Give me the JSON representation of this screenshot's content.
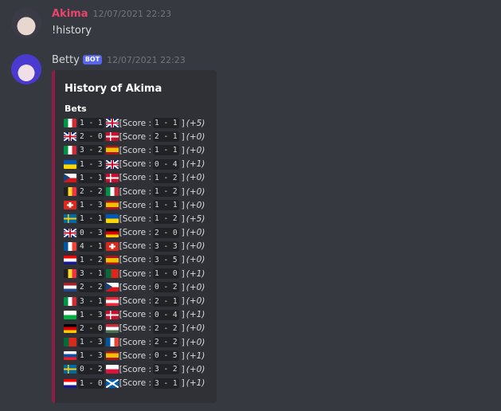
{
  "messages": [
    {
      "author": "Akima",
      "timestamp": "12/07/2021 22:23",
      "text": "!history"
    },
    {
      "author": "Betty",
      "bot_tag": "BOT",
      "timestamp": "12/07/2021 22:23",
      "embed": {
        "title": "History of Akima",
        "field": "Bets",
        "score_label": "[Score :",
        "bets": [
          {
            "home_icon": "flag-italy",
            "away_icon": "flag-uk",
            "bet": "1 - 1",
            "score": "1 - 1",
            "points": "(+5)"
          },
          {
            "home_icon": "flag-uk",
            "away_icon": "flag-denmark",
            "bet": "2 - 0",
            "score": "2 - 1",
            "points": "(+0)"
          },
          {
            "home_icon": "flag-italy",
            "away_icon": "flag-spain",
            "bet": "3 - 2",
            "score": "1 - 1",
            "points": "(+0)"
          },
          {
            "home_icon": "flag-ukraine",
            "away_icon": "flag-uk",
            "bet": "1 - 3",
            "score": "0 - 4",
            "points": "(+1)"
          },
          {
            "home_icon": "flag-czechia",
            "away_icon": "flag-denmark",
            "bet": "1 - 1",
            "score": "1 - 2",
            "points": "(+0)"
          },
          {
            "home_icon": "flag-belgium",
            "away_icon": "flag-italy",
            "bet": "2 - 2",
            "score": "1 - 2",
            "points": "(+0)"
          },
          {
            "home_icon": "flag-switzerland",
            "away_icon": "flag-spain",
            "bet": "1 - 3",
            "score": "1 - 1",
            "points": "(+0)"
          },
          {
            "home_icon": "flag-sweden",
            "away_icon": "flag-ukraine",
            "bet": "1 - 1",
            "score": "1 - 2",
            "points": "(+5)"
          },
          {
            "home_icon": "flag-uk",
            "away_icon": "flag-germany",
            "bet": "0 - 3",
            "score": "2 - 0",
            "points": "(+0)"
          },
          {
            "home_icon": "flag-france",
            "away_icon": "flag-switzerland",
            "bet": "4 - 1",
            "score": "3 - 3",
            "points": "(+0)"
          },
          {
            "home_icon": "flag-croatia",
            "away_icon": "flag-spain",
            "bet": "1 - 2",
            "score": "3 - 5",
            "points": "(+0)"
          },
          {
            "home_icon": "flag-belgium",
            "away_icon": "flag-portugal",
            "bet": "3 - 1",
            "score": "1 - 0",
            "points": "(+1)"
          },
          {
            "home_icon": "flag-netherlands",
            "away_icon": "flag-czechia",
            "bet": "2 - 2",
            "score": "0 - 2",
            "points": "(+0)"
          },
          {
            "home_icon": "flag-italy",
            "away_icon": "flag-austria",
            "bet": "3 - 1",
            "score": "2 - 1",
            "points": "(+0)"
          },
          {
            "home_icon": "flag-wales",
            "away_icon": "flag-denmark",
            "bet": "1 - 3",
            "score": "0 - 4",
            "points": "(+1)"
          },
          {
            "home_icon": "flag-germany",
            "away_icon": "flag-hungary",
            "bet": "2 - 0",
            "score": "2 - 2",
            "points": "(+0)"
          },
          {
            "home_icon": "flag-portugal",
            "away_icon": "flag-france",
            "bet": "1 - 3",
            "score": "2 - 2",
            "points": "(+0)"
          },
          {
            "home_icon": "flag-slovakia",
            "away_icon": "flag-spain",
            "bet": "1 - 3",
            "score": "0 - 5",
            "points": "(+1)"
          },
          {
            "home_icon": "flag-sweden",
            "away_icon": "flag-poland",
            "bet": "0 - 2",
            "score": "3 - 2",
            "points": "(+0)"
          },
          {
            "home_icon": "flag-croatia",
            "away_icon": "flag-scotland",
            "bet": "1 - 0",
            "score": "3 - 1",
            "points": "(+1)"
          }
        ]
      }
    }
  ],
  "colors": {
    "background": "#36393f",
    "embed_bg": "#2f3136",
    "embed_accent": "#8f1d44",
    "akima_name": "#e8456b",
    "bot_badge": "#5865f2"
  }
}
